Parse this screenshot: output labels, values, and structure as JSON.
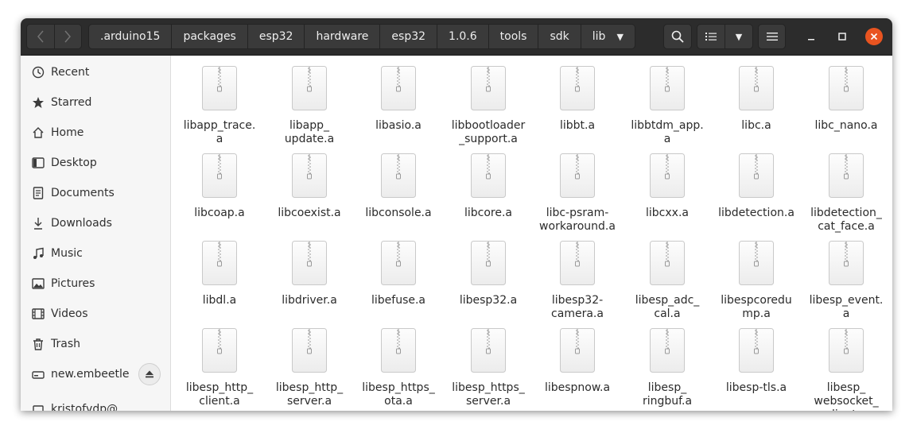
{
  "header": {
    "path": [
      ".arduino15",
      "packages",
      "esp32",
      "hardware",
      "esp32",
      "1.0.6",
      "tools",
      "sdk",
      "lib"
    ],
    "icons": {
      "back": "chevron-left-icon",
      "forward": "chevron-right-icon",
      "search": "search-icon",
      "view": "list-view-icon",
      "view_menu": "chevron-down-icon",
      "menu": "hamburger-icon",
      "minimize": "minimize-icon",
      "maximize": "maximize-icon",
      "close": "close-icon"
    },
    "close_color": "#e95420"
  },
  "sidebar": {
    "items": [
      {
        "label": "Recent",
        "icon": "clock-icon"
      },
      {
        "label": "Starred",
        "icon": "star-icon"
      },
      {
        "label": "Home",
        "icon": "home-icon"
      },
      {
        "label": "Desktop",
        "icon": "desktop-icon"
      },
      {
        "label": "Documents",
        "icon": "documents-icon"
      },
      {
        "label": "Downloads",
        "icon": "download-icon"
      },
      {
        "label": "Music",
        "icon": "music-icon"
      },
      {
        "label": "Pictures",
        "icon": "pictures-icon"
      },
      {
        "label": "Videos",
        "icon": "videos-icon"
      },
      {
        "label": "Trash",
        "icon": "trash-icon"
      },
      {
        "label": "new.embeetle",
        "icon": "drive-icon"
      }
    ],
    "partial_item": "kristofvdp@..."
  },
  "files": [
    "libapp_trace.\na",
    "libapp_\nupdate.a",
    "libasio.a",
    "libbootloader\n_support.a",
    "libbt.a",
    "libbtdm_app.\na",
    "libc.a",
    "libc_nano.a",
    "libcoap.a",
    "libcoexist.a",
    "libconsole.a",
    "libcore.a",
    "libc-psram-\nworkaround.a",
    "libcxx.a",
    "libdetection.a",
    "libdetection_\ncat_face.a",
    "libdl.a",
    "libdriver.a",
    "libefuse.a",
    "libesp32.a",
    "libesp32-\ncamera.a",
    "libesp_adc_\ncal.a",
    "libespcoredu\nmp.a",
    "libesp_event.\na",
    "libesp_http_\nclient.a",
    "libesp_http_\nserver.a",
    "libesp_https_\nota.a",
    "libesp_https_\nserver.a",
    "libespnow.a",
    "libesp_\nringbuf.a",
    "libesp-tls.a",
    "libesp_\nwebsocket_\nclient.a"
  ]
}
